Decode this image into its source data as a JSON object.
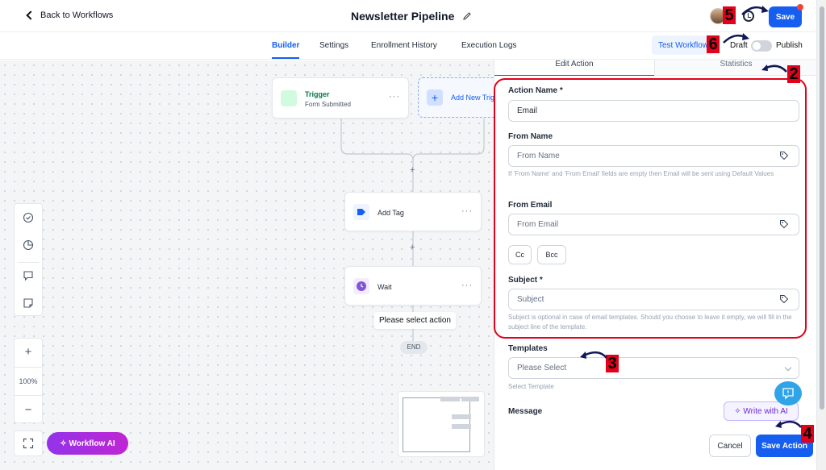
{
  "header": {
    "back_label": "Back to Workflows",
    "title": "Newsletter Pipeline",
    "save_label": "Save"
  },
  "tabs": [
    {
      "label": "Builder",
      "active": true
    },
    {
      "label": "Settings"
    },
    {
      "label": "Enrollment History"
    },
    {
      "label": "Execution Logs"
    }
  ],
  "controls": {
    "test_workflow_label": "Test Workflow",
    "draft_label": "Draft",
    "publish_label": "Publish",
    "published": false
  },
  "canvas": {
    "trigger": {
      "name": "Trigger",
      "subtitle": "Form Submitted"
    },
    "add_trigger_label": "Add New Trigger",
    "add_tag": {
      "name": "Add Tag"
    },
    "wait": {
      "name": "Wait"
    },
    "tooltip": "Please select action",
    "end_label": "END",
    "zoom_level": "100%",
    "workflow_ai_label": "Workflow AI"
  },
  "panel": {
    "tabs": [
      "Edit Action",
      "Statistics"
    ],
    "action_name_label": "Action Name *",
    "action_name_value": "Email",
    "from_name_label": "From Name",
    "from_name_placeholder": "From Name",
    "from_name_help": "If 'From Name' and 'From Email' fields are empty then Email will be sent using Default Values",
    "from_email_label": "From Email",
    "from_email_placeholder": "From Email",
    "cc_label": "Cc",
    "bcc_label": "Bcc",
    "subject_label": "Subject *",
    "subject_placeholder": "Subject",
    "subject_help": "Subject is optional in case of email templates. Should you choose to leave it empty, we will fill in the subject line of the template.",
    "templates_label": "Templates",
    "templates_placeholder": "Please Select",
    "templates_help": "Select Template",
    "message_label": "Message",
    "write_ai_label": "Write with AI",
    "cancel_label": "Cancel",
    "save_action_label": "Save Action"
  },
  "annotations": [
    "2",
    "3",
    "4",
    "5",
    "6"
  ],
  "colors": {
    "accent": "#155eef",
    "annotation_red": "#e4001b",
    "ai_purple": "#9333ea"
  }
}
